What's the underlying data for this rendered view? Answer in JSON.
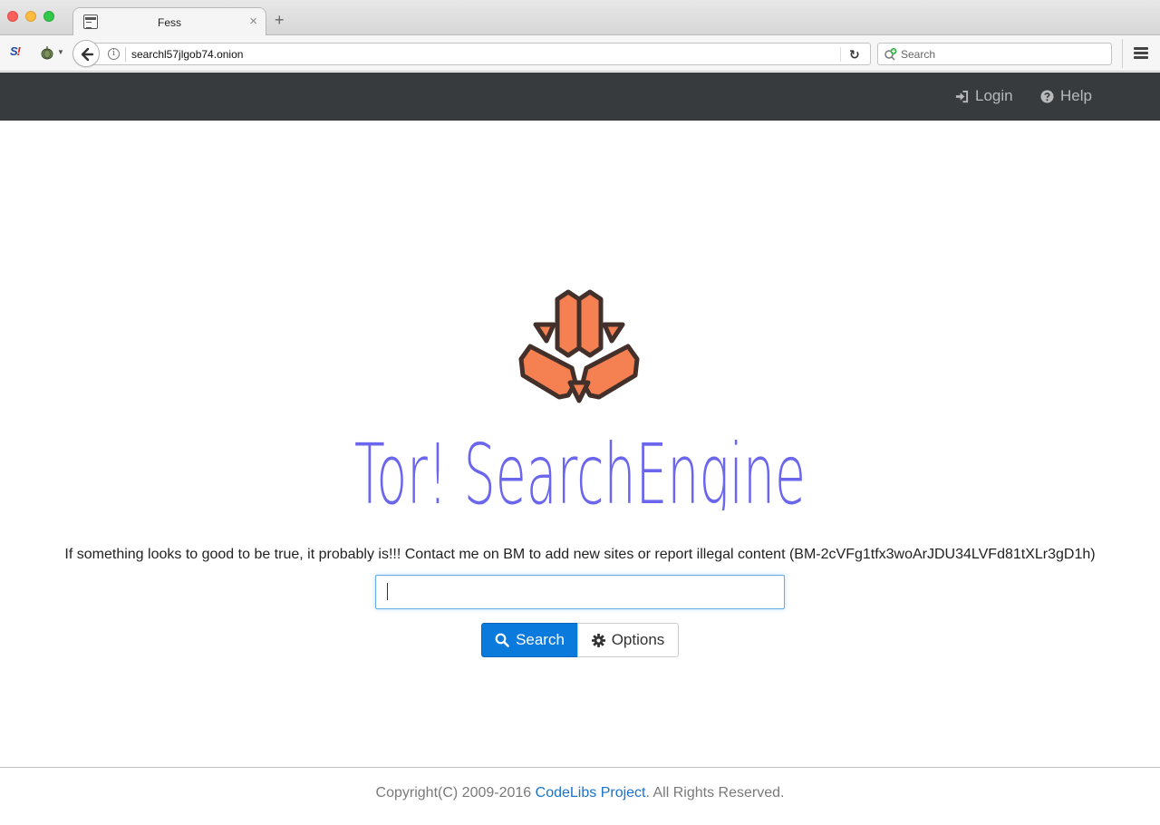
{
  "browser": {
    "tab_title": "Fess",
    "tab_close": "×",
    "new_tab": "+",
    "url": "searchl57jlgob74.onion",
    "search_placeholder": "Search",
    "extension_label": "S!"
  },
  "nav": {
    "login": "Login",
    "help": "Help"
  },
  "brand": {
    "title": "Tor! SearchEngine",
    "logo_color": "#f58052",
    "title_color": "#6b66ee"
  },
  "notice": "If something looks to good to be true, it probably is!!! Contact me on BM to add new sites or report illegal content (BM-2cVFg1tfx3woArJDU34LVFd81tXLr3gD1h)",
  "search": {
    "query": "",
    "search_button": "Search",
    "options_button": "Options"
  },
  "footer": {
    "prefix": "Copyright(C) 2009-2016 ",
    "link": "CodeLibs Project",
    "suffix": ". All Rights Reserved."
  }
}
